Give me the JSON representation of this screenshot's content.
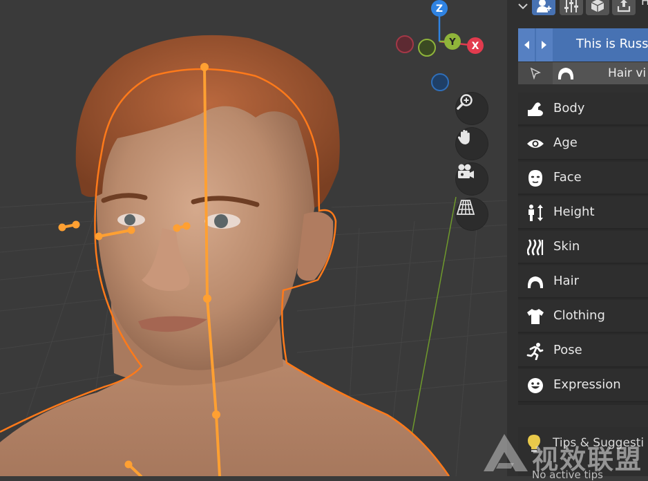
{
  "viewport": {
    "gizmo": {
      "z_label": "Z",
      "y_label": "Y",
      "x_label": "X"
    },
    "tools": [
      {
        "icon": "zoom-icon"
      },
      {
        "icon": "hand-pan-icon"
      },
      {
        "icon": "camera-icon"
      },
      {
        "icon": "perspective-grid-icon"
      }
    ]
  },
  "panel": {
    "header_letter": "H",
    "preset_name": "This is Russ",
    "hair_visibility_label": "Hair vi",
    "categories": [
      {
        "label": "Body",
        "icon": "body-arm-icon"
      },
      {
        "label": "Age",
        "icon": "eye-icon"
      },
      {
        "label": "Face",
        "icon": "face-icon"
      },
      {
        "label": "Height",
        "icon": "height-icon"
      },
      {
        "label": "Skin",
        "icon": "skin-icon"
      },
      {
        "label": "Hair",
        "icon": "hair-icon"
      },
      {
        "label": "Clothing",
        "icon": "shirt-icon"
      },
      {
        "label": "Pose",
        "icon": "running-figure-icon"
      },
      {
        "label": "Expression",
        "icon": "smiley-icon"
      }
    ],
    "tips_title": "Tips & Suggesti",
    "tips_sub": "No active tips"
  },
  "watermark": "视效联盟",
  "colors": {
    "accent": "#4772b3",
    "axis_x": "#e23b4e",
    "axis_y": "#8fb43a",
    "axis_z": "#2f83e2",
    "armature": "#ffa032",
    "outline": "#ff7a1a"
  }
}
